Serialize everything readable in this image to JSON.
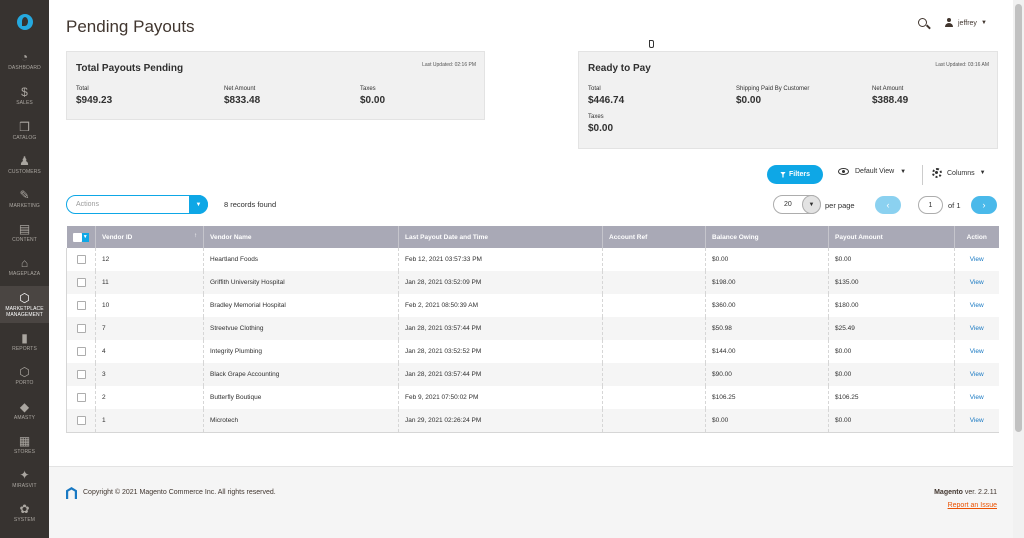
{
  "sidebar": {
    "items": [
      {
        "label": "Dashboard",
        "icon": "dashboard-icon",
        "glyph": "◔"
      },
      {
        "label": "Sales",
        "icon": "sales-icon",
        "glyph": "$"
      },
      {
        "label": "Catalog",
        "icon": "catalog-icon",
        "glyph": "❒"
      },
      {
        "label": "Customers",
        "icon": "customers-icon",
        "glyph": "♟"
      },
      {
        "label": "Marketing",
        "icon": "marketing-icon",
        "glyph": "✎"
      },
      {
        "label": "Content",
        "icon": "content-icon",
        "glyph": "▤"
      },
      {
        "label": "Mageplaza",
        "icon": "mageplaza-icon",
        "glyph": "⌂"
      },
      {
        "label": "Marketplace Management",
        "icon": "marketplace-icon",
        "glyph": "⬡"
      },
      {
        "label": "Reports",
        "icon": "reports-icon",
        "glyph": "▮"
      },
      {
        "label": "Porto",
        "icon": "porto-icon",
        "glyph": "⬡"
      },
      {
        "label": "Amasty",
        "icon": "amasty-icon",
        "glyph": "◆"
      },
      {
        "label": "Stores",
        "icon": "stores-icon",
        "glyph": "▦"
      },
      {
        "label": "Mirasvit",
        "icon": "mirasvit-icon",
        "glyph": "✦"
      },
      {
        "label": "System",
        "icon": "system-icon",
        "glyph": "✿"
      }
    ]
  },
  "header": {
    "title": "Pending Payouts",
    "user": "jeffrey"
  },
  "pending_panel": {
    "title": "Total Payouts Pending",
    "updated": "Last Updated: 02:16 PM",
    "metrics": [
      {
        "label": "Total",
        "value": "$949.23"
      },
      {
        "label": "Net Amount",
        "value": "$833.48"
      },
      {
        "label": "Taxes",
        "value": "$0.00"
      }
    ]
  },
  "ready_panel": {
    "title": "Ready to Pay",
    "updated": "Last Updated: 03:16 AM",
    "metrics": [
      {
        "label": "Total",
        "value": "$446.74"
      },
      {
        "label": "Shipping Paid By Customer",
        "value": "$0.00"
      },
      {
        "label": "Net Amount",
        "value": "$388.49"
      },
      {
        "label": "Taxes",
        "value": "$0.00"
      }
    ]
  },
  "toolbar": {
    "filters_label": "Filters",
    "view_label": "Default View",
    "columns_label": "Columns",
    "actions_placeholder": "Actions",
    "records_found": "8 records found",
    "per_page_value": "20",
    "per_page_label": "per page",
    "page_current": "1",
    "page_total": "of 1"
  },
  "grid": {
    "columns": [
      "Vendor ID",
      "Vendor Name",
      "Last Payout Date and Time",
      "Account Ref",
      "Balance Owing",
      "Payout Amount",
      "Action"
    ],
    "rows": [
      {
        "id": "12",
        "name": "Heartland Foods",
        "date": "Feb 12, 2021 03:57:33 PM",
        "ref": "",
        "balance": "$0.00",
        "payout": "$0.00",
        "action": "View"
      },
      {
        "id": "11",
        "name": "Griffith University Hospital",
        "date": "Jan 28, 2021 03:52:09 PM",
        "ref": "",
        "balance": "$198.00",
        "payout": "$135.00",
        "action": "View"
      },
      {
        "id": "10",
        "name": "Bradley Memorial Hospital",
        "date": "Feb 2, 2021 08:50:39 AM",
        "ref": "",
        "balance": "$360.00",
        "payout": "$180.00",
        "action": "View"
      },
      {
        "id": "7",
        "name": "Streetvue Clothing",
        "date": "Jan 28, 2021 03:57:44 PM",
        "ref": "",
        "balance": "$50.98",
        "payout": "$25.49",
        "action": "View"
      },
      {
        "id": "4",
        "name": "Integrity Plumbing",
        "date": "Jan 28, 2021 03:52:52 PM",
        "ref": "",
        "balance": "$144.00",
        "payout": "$0.00",
        "action": "View"
      },
      {
        "id": "3",
        "name": "Black Grape Accounting",
        "date": "Jan 28, 2021 03:57:44 PM",
        "ref": "",
        "balance": "$90.00",
        "payout": "$0.00",
        "action": "View"
      },
      {
        "id": "2",
        "name": "Butterfly Boutique",
        "date": "Feb 9, 2021 07:50:02 PM",
        "ref": "",
        "balance": "$106.25",
        "payout": "$106.25",
        "action": "View"
      },
      {
        "id": "1",
        "name": "Microtech",
        "date": "Jan 29, 2021 02:26:24 PM",
        "ref": "",
        "balance": "$0.00",
        "payout": "$0.00",
        "action": "View"
      }
    ]
  },
  "footer": {
    "copyright": "Copyright © 2021 Magento Commerce Inc. All rights reserved.",
    "brand": "Magento",
    "version": " ver. 2.2.11",
    "report_link": "Report an Issue"
  },
  "colors": {
    "sidebar_bg": "#373330",
    "accent": "#0ea7e6",
    "link": "#1979c3",
    "report_link": "#eb5202"
  }
}
